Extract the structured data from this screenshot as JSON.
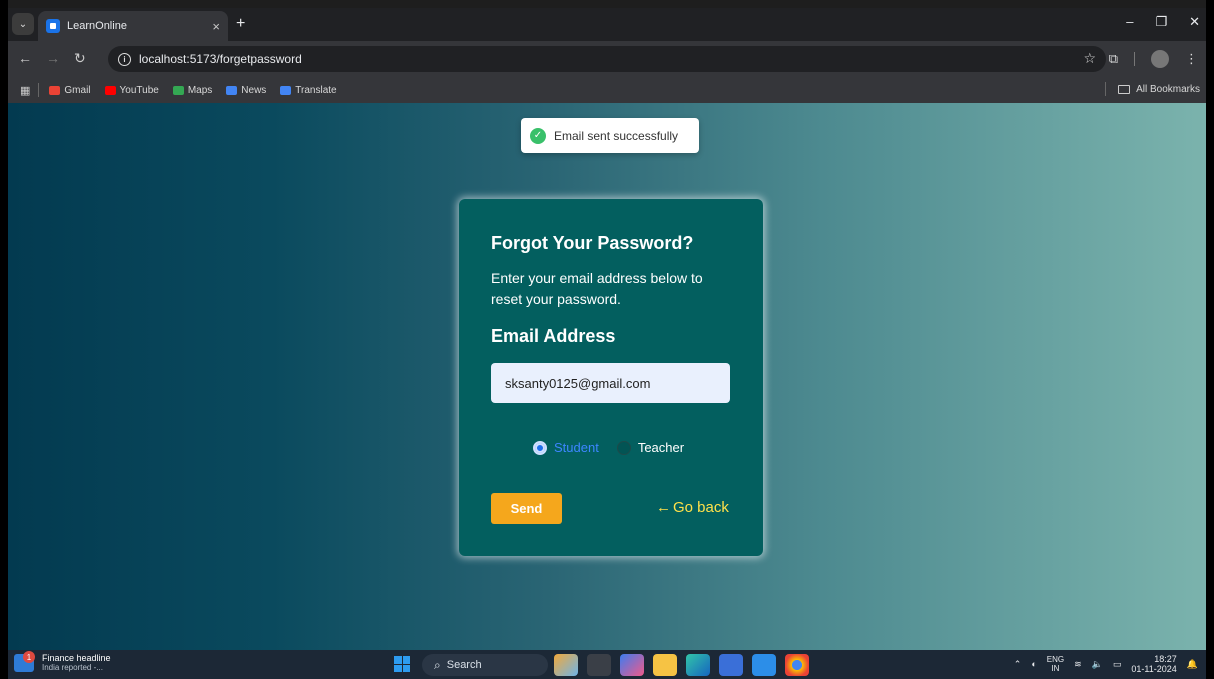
{
  "browser": {
    "tab_title": "LearnOnline",
    "tab_close": "×",
    "new_tab": "+",
    "url": "localhost:5173/forgetpassword",
    "bookmarks": [
      {
        "label": "Gmail",
        "color": "#ea4335"
      },
      {
        "label": "YouTube",
        "color": "#ff0000"
      },
      {
        "label": "Maps",
        "color": "#34a853"
      },
      {
        "label": "News",
        "color": "#4285f4"
      },
      {
        "label": "Translate",
        "color": "#4285f4"
      }
    ],
    "all_bookmarks": "All Bookmarks"
  },
  "toast": {
    "message": "Email sent successfully",
    "icon": "check-circle-icon",
    "color": "#39c06a"
  },
  "form": {
    "title": "Forgot Your Password?",
    "description": "Enter your email address below to reset your password.",
    "email_label": "Email Address",
    "email_value": "sksanty0125@gmail.com",
    "roles": [
      {
        "label": "Student",
        "checked": true
      },
      {
        "label": "Teacher",
        "checked": false
      }
    ],
    "send_label": "Send",
    "go_back_label": "Go back",
    "card_color": "#035f5f",
    "send_color": "#f5a71c",
    "go_back_color": "#ffe14a"
  },
  "taskbar": {
    "news_title": "Finance headline",
    "news_sub": "India reported -...",
    "news_badge": "1",
    "search_label": "Search",
    "lang_top": "ENG",
    "lang_bottom": "IN",
    "time": "18:27",
    "date": "01-11-2024"
  }
}
